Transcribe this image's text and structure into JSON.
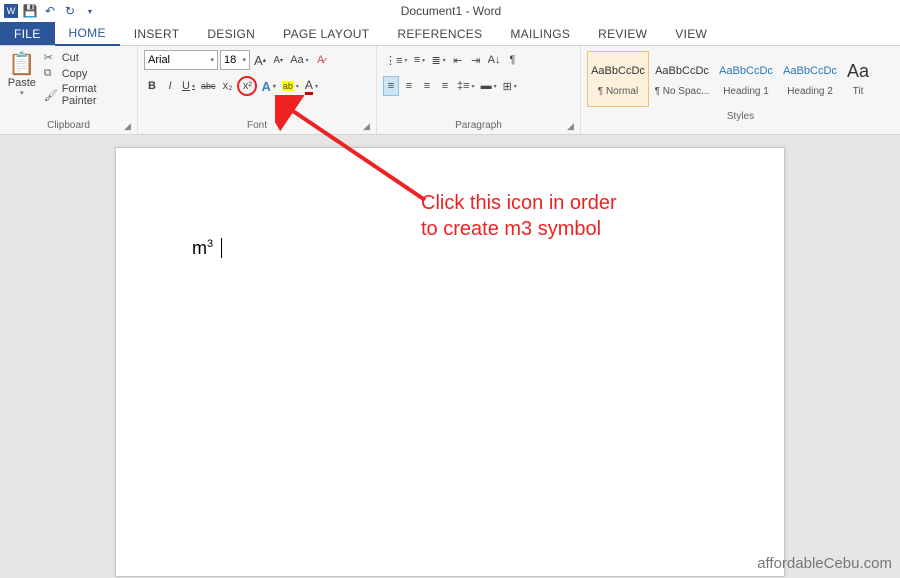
{
  "titlebar": {
    "doc_title": "Document1 - Word"
  },
  "tabs": {
    "file": "FILE",
    "home": "HOME",
    "insert": "INSERT",
    "design": "DESIGN",
    "page_layout": "PAGE LAYOUT",
    "references": "REFERENCES",
    "mailings": "MAILINGS",
    "review": "REVIEW",
    "view": "VIEW"
  },
  "clipboard": {
    "paste": "Paste",
    "cut": "Cut",
    "copy": "Copy",
    "format_painter": "Format Painter",
    "group_label": "Clipboard"
  },
  "font": {
    "name": "Arial",
    "size": "18",
    "group_label": "Font",
    "grow": "A",
    "shrink": "A",
    "case": "Aa",
    "clear": "✎",
    "bold": "B",
    "italic": "I",
    "underline": "U",
    "strike": "abc",
    "subscript": "x₂",
    "superscript": "x²",
    "text_effect": "A",
    "highlight": "ab",
    "font_color": "A"
  },
  "paragraph": {
    "group_label": "Paragraph"
  },
  "styles": {
    "group_label": "Styles",
    "items": [
      {
        "preview": "AaBbCcDc",
        "name": "¶ Normal"
      },
      {
        "preview": "AaBbCcDc",
        "name": "¶ No Spac..."
      },
      {
        "preview": "AaBbCcDc",
        "name": "Heading 1"
      },
      {
        "preview": "AaBbCcDc",
        "name": "Heading 2"
      },
      {
        "preview": "Aa",
        "name": "Tit"
      }
    ]
  },
  "document": {
    "text_m": "m",
    "text_sup": "3"
  },
  "annotation": {
    "line1": "Click this icon in order",
    "line2": "to create m3 symbol"
  },
  "watermark": "affordableCebu.com"
}
